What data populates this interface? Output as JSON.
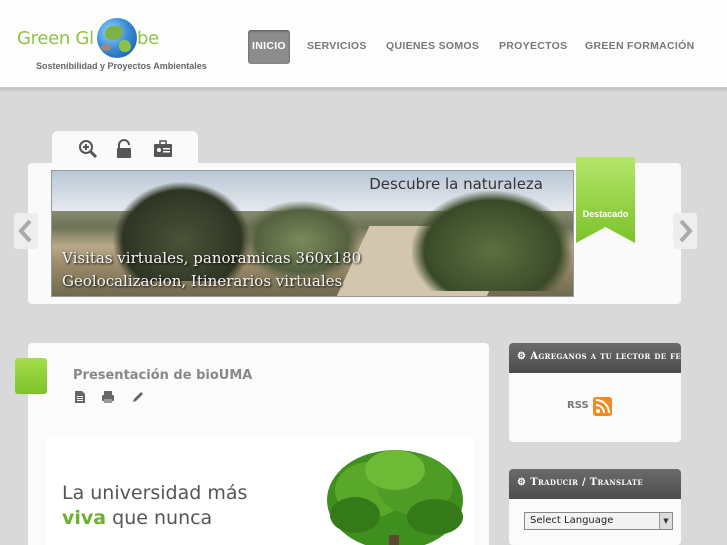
{
  "logo": {
    "text_left": "Green Gl",
    "text_right": "be",
    "tagline": "Sostenibilidad y Proyectos Ambientales",
    "brand_color": "#8dc63f"
  },
  "nav": {
    "items": [
      {
        "label": "INICIO",
        "active": true
      },
      {
        "label": "SERVICIOS",
        "active": false
      },
      {
        "label": "QUIENES SOMOS",
        "active": false
      },
      {
        "label": "PROYECTOS",
        "active": false
      },
      {
        "label": "GREEN FORMACIÓN",
        "active": false
      }
    ]
  },
  "slider": {
    "tab_icons": [
      "zoom-in-icon",
      "lock-icon",
      "id-card-icon"
    ],
    "slide_title": "Descubre la naturaleza",
    "caption_line1": "Visitas virtuales, panoramicas 360x180",
    "caption_line2": "Geolocalizacion, Itinerarios virtuales",
    "ribbon_label": "Destacado",
    "ribbon_color": "#8dc63f"
  },
  "article": {
    "title": "Presentación de bioUMA",
    "icons": [
      "document-icon",
      "print-icon",
      "edit-icon"
    ],
    "banner_line1": "La universidad más",
    "banner_highlight": "viva",
    "banner_rest": "que nunca",
    "highlight_color": "#6bb22a"
  },
  "sidebar": {
    "feeds_title": "Agreganos a tu lector de feeds",
    "rss_label": "RSS",
    "translate_title": "Traducir / Translate",
    "language_select": "Select Language"
  }
}
